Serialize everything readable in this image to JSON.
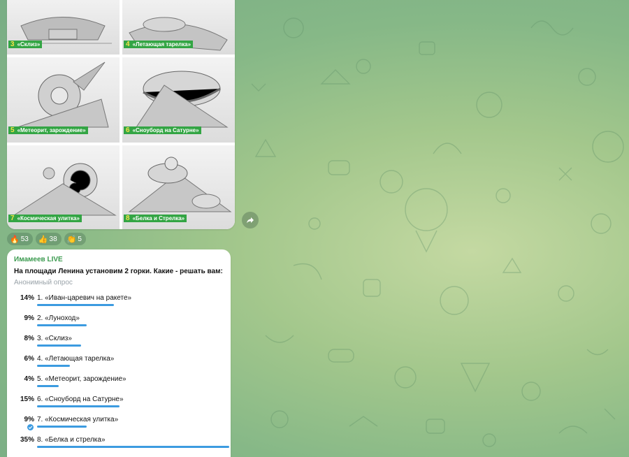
{
  "album": {
    "tiles": [
      {
        "num": "3",
        "caption": "«Склиз»"
      },
      {
        "num": "4",
        "caption": "«Летающая тарелка»"
      },
      {
        "num": "5",
        "caption": "«Метеорит, зарождение»"
      },
      {
        "num": "6",
        "caption": "«Сноуборд на Сатурне»"
      },
      {
        "num": "7",
        "caption": "«Космическая улитка»"
      },
      {
        "num": "8",
        "caption": "«Белка и Стрелка»"
      }
    ]
  },
  "reactions": [
    {
      "emoji": "🔥",
      "count": "53"
    },
    {
      "emoji": "👍",
      "count": "38"
    },
    {
      "emoji": "👏",
      "count": "5"
    }
  ],
  "poll": {
    "author": "Имамеев LIVE",
    "question": "На площади Ленина установим 2 горки. Какие - решать вам:",
    "type": "Анонимный опрос",
    "accent_color": "#3c9be0",
    "options": [
      {
        "percent": "14%",
        "label": "1. «Иван-царевич на ракете»",
        "value": 14,
        "voted": false
      },
      {
        "percent": "9%",
        "label": "2. «Луноход»",
        "value": 9,
        "voted": false
      },
      {
        "percent": "8%",
        "label": "3. «Склиз»",
        "value": 8,
        "voted": false
      },
      {
        "percent": "6%",
        "label": "4. «Летающая тарелка»",
        "value": 6,
        "voted": false
      },
      {
        "percent": "4%",
        "label": "5. «Метеорит, зарождение»",
        "value": 4,
        "voted": false
      },
      {
        "percent": "15%",
        "label": "6. «Сноуборд на Сатурне»",
        "value": 15,
        "voted": false
      },
      {
        "percent": "9%",
        "label": "7. «Космическая улитка»",
        "value": 9,
        "voted": true
      },
      {
        "percent": "35%",
        "label": "8. «Белка и стрелка»",
        "value": 35,
        "voted": false
      }
    ]
  },
  "icons": {
    "forward": "share-arrow-icon",
    "voted": "checkmark-icon"
  }
}
